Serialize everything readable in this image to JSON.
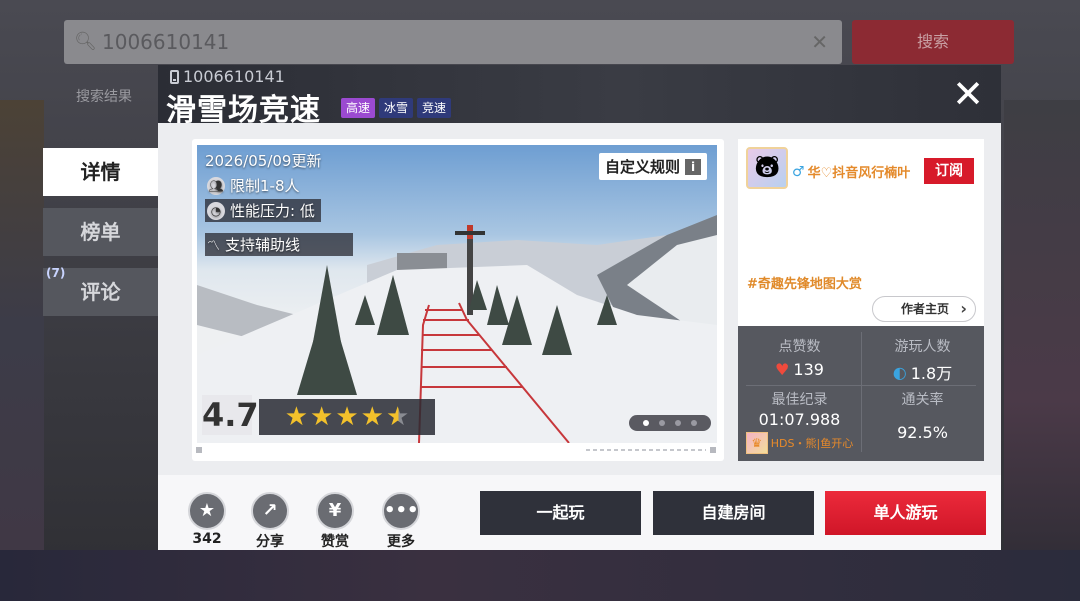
{
  "background": {
    "search_value": "1006610141",
    "search_button": "搜索",
    "history_label": "搜索结果"
  },
  "map": {
    "id": "1006610141",
    "title": "滑雪场竞速",
    "tags": [
      {
        "label": "高速",
        "color": "#9b4ad1"
      },
      {
        "label": "冰雪",
        "color": "#2f3a7a"
      },
      {
        "label": "竞速",
        "color": "#2f3a7a"
      }
    ]
  },
  "side_tabs": {
    "details": "详情",
    "leaderboard": "榜单",
    "comments": "评论",
    "comments_badge": "(7)"
  },
  "preview": {
    "updated": "2026/05/09更新",
    "players": "限制1-8人",
    "performance": "性能压力: 低",
    "assist": "支持辅助线",
    "rules_button": "自定义规则",
    "rating": "4.7",
    "stars_full": 4,
    "stars_half": 1,
    "page_count": 4,
    "page_current": 1
  },
  "author": {
    "name": "华♡抖音风行楠叶",
    "subscribe": "订阅",
    "tagline": "#奇趣先锋地图大赏",
    "home_button": "作者主页"
  },
  "stats": {
    "likes_label": "点赞数",
    "likes_value": "139",
    "players_label": "游玩人数",
    "players_value": "1.8万",
    "record_label": "最佳纪录",
    "record_value": "01:07.988",
    "record_holder": "HDS・熊|鱼开心",
    "clear_label": "通关率",
    "clear_value": "92.5%"
  },
  "actions": {
    "favorite_count": "342",
    "share": "分享",
    "reward": "赞赏",
    "more": "更多"
  },
  "buttons": {
    "play_together": "一起玩",
    "create_room": "自建房间",
    "solo_play": "单人游玩"
  }
}
